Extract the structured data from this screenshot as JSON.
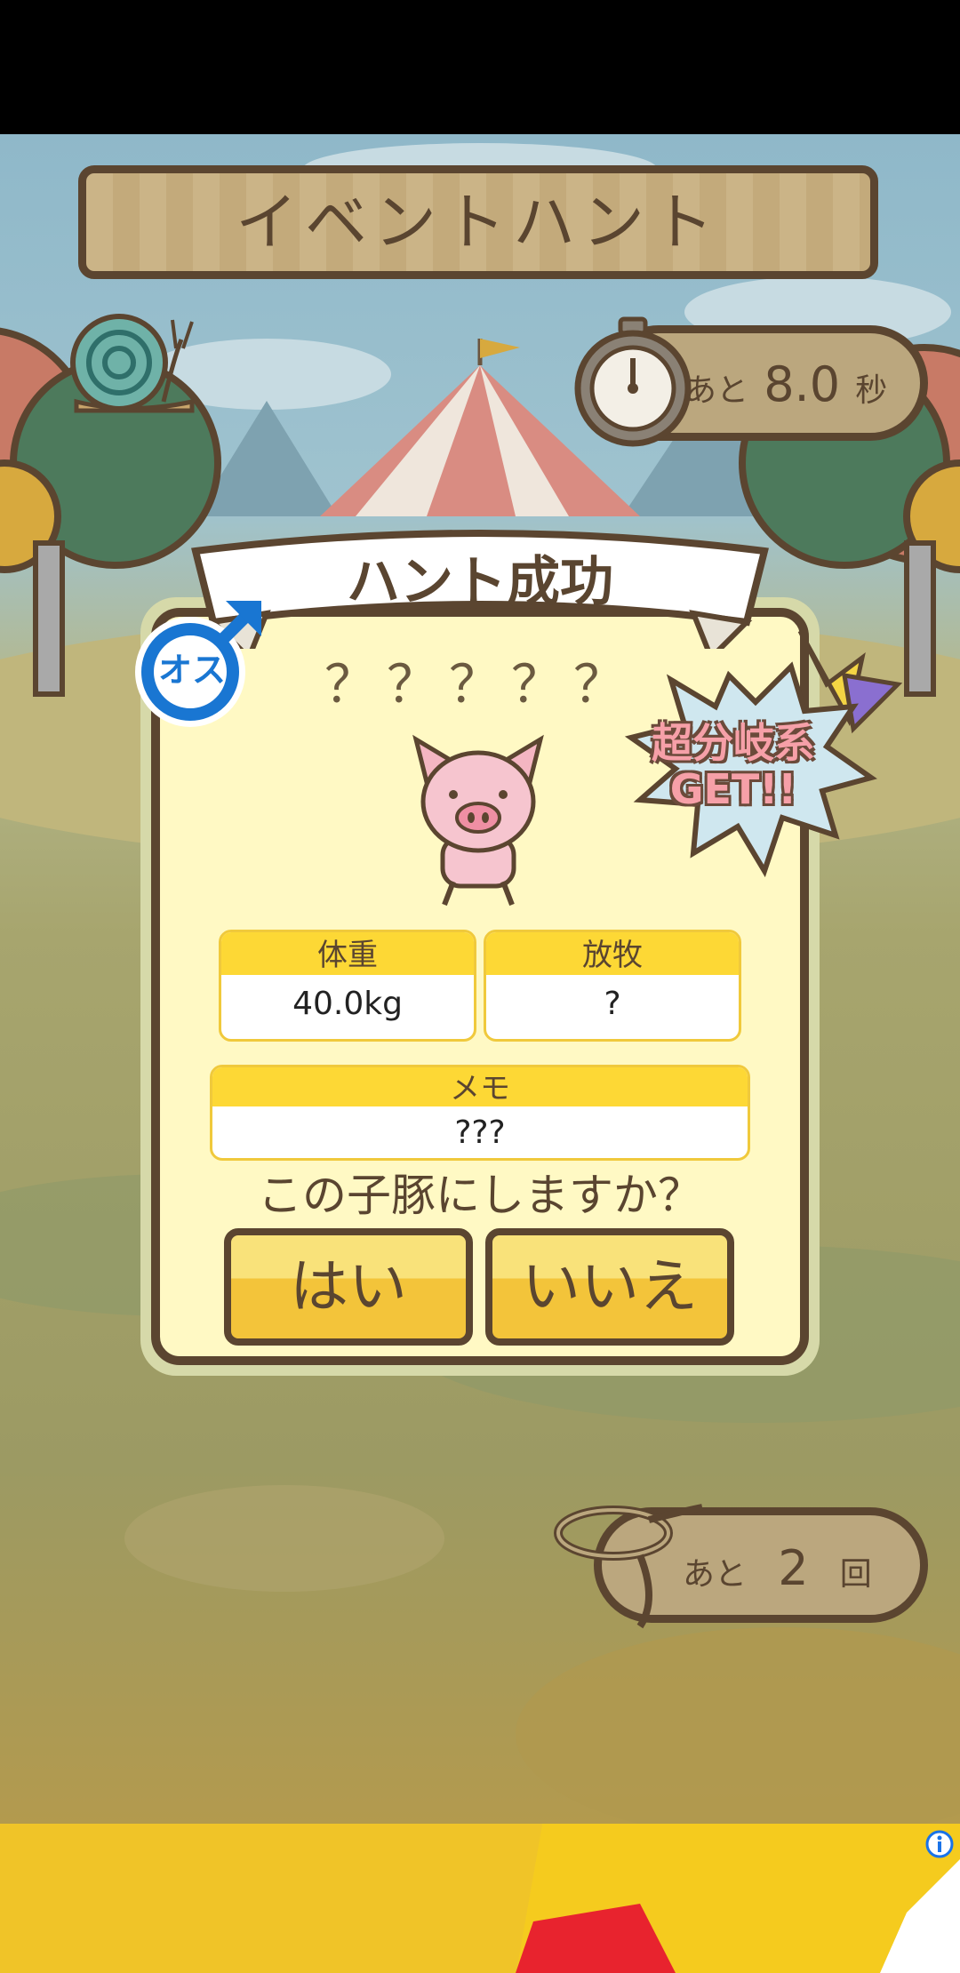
{
  "header": {
    "title": "イベントハント"
  },
  "timer": {
    "prefix": "あと",
    "value": "8.0",
    "unit": "秒"
  },
  "result": {
    "banner": "ハント成功",
    "gender_badge": "オス",
    "pig_name": "？？？？？",
    "burst_line1": "超分岐系",
    "burst_line2": "GET!!",
    "weight_label": "体重",
    "weight_value": "40.0kg",
    "grazing_label": "放牧",
    "grazing_value": "?",
    "memo_label": "メモ",
    "memo_value": "???",
    "question": "この子豚にしますか？",
    "yes_label": "はい",
    "no_label": "いいえ"
  },
  "attempts": {
    "prefix": "あと",
    "value": "2",
    "unit": "回"
  },
  "ad": {
    "info_icon": "info-icon"
  },
  "colors": {
    "wood_border": "#5b4530",
    "card_bg": "#fff9c4",
    "button_yellow": "#f3c43a",
    "male_blue": "#1976d2"
  }
}
